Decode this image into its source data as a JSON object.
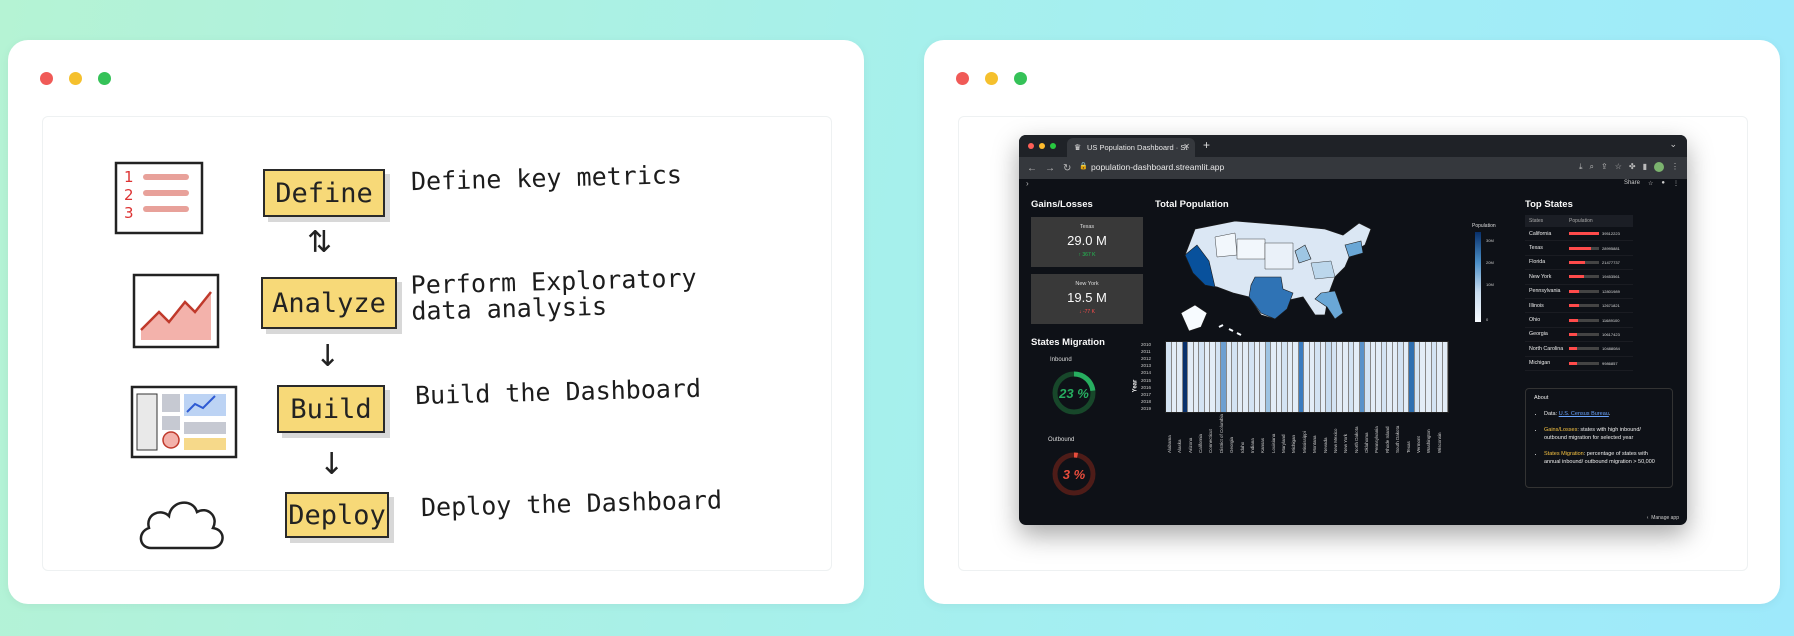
{
  "workflow": {
    "steps": [
      {
        "label": "Define",
        "description": "Define key metrics"
      },
      {
        "label": "Analyze",
        "description": "Perform Exploratory data analysis"
      },
      {
        "label": "Build",
        "description": "Build the Dashboard"
      },
      {
        "label": "Deploy",
        "description": "Deploy the Dashboard"
      }
    ],
    "icon_list_numbers": [
      "1",
      "2",
      "3"
    ]
  },
  "browser": {
    "tab_title": "US Population Dashboard · St",
    "url": "population-dashboard.streamlit.app",
    "share_label": "Share"
  },
  "dashboard": {
    "gains_losses": {
      "title": "Gains/Losses",
      "metrics": [
        {
          "label": "Texas",
          "value": "29.0 M",
          "delta": "↑ 367 K",
          "delta_color": "#21c354"
        },
        {
          "label": "New York",
          "value": "19.5 M",
          "delta": "↓ -77 K",
          "delta_color": "#ff4b4b"
        }
      ]
    },
    "migration": {
      "title": "States Migration",
      "inbound": {
        "label": "Inbound",
        "value": "23 %",
        "fraction": 0.23,
        "color": "#27ae60"
      },
      "outbound": {
        "label": "Outbound",
        "value": "3 %",
        "fraction": 0.03,
        "color": "#e74c3c"
      }
    },
    "map": {
      "title": "Total Population",
      "legend": {
        "title": "Population",
        "ticks": [
          "30M",
          "20M",
          "10M",
          "0"
        ]
      }
    },
    "heatmap": {
      "y_title": "Year",
      "years": [
        "2010",
        "2011",
        "2012",
        "2013",
        "2014",
        "2015",
        "2016",
        "2017",
        "2018",
        "2019"
      ],
      "states": [
        "Alabama",
        "Alaska",
        "Arizona",
        "California",
        "Connecticut",
        "District of Columbia",
        "Georgia",
        "Idaho",
        "Indiana",
        "Kansas",
        "Louisiana",
        "Maryland",
        "Michigan",
        "Mississippi",
        "Montana",
        "Nevada",
        "New Mexico",
        "New York",
        "North Dakota",
        "Oklahoma",
        "Pennsylvania",
        "Rhode Island",
        "South Dakota",
        "Texas",
        "Vermont",
        "Washington",
        "Wisconsin"
      ]
    },
    "top_states": {
      "title": "Top States",
      "columns": [
        "States",
        "Population"
      ],
      "rows": [
        {
          "state": "California",
          "population": "39512223",
          "fraction": 1.0
        },
        {
          "state": "Texas",
          "population": "28995881",
          "fraction": 0.73
        },
        {
          "state": "Florida",
          "population": "21477737",
          "fraction": 0.54
        },
        {
          "state": "New York",
          "population": "19453561",
          "fraction": 0.49
        },
        {
          "state": "Pennsylvania",
          "population": "12801989",
          "fraction": 0.32
        },
        {
          "state": "Illinois",
          "population": "12671821",
          "fraction": 0.32
        },
        {
          "state": "Ohio",
          "population": "11689100",
          "fraction": 0.3
        },
        {
          "state": "Georgia",
          "population": "10617423",
          "fraction": 0.27
        },
        {
          "state": "North Carolina",
          "population": "10488084",
          "fraction": 0.27
        },
        {
          "state": "Michigan",
          "population": "9986857",
          "fraction": 0.25
        }
      ]
    },
    "about": {
      "title": "About",
      "data_prefix": "Data: ",
      "data_link": "U.S. Census Bureau",
      "data_suffix": ".",
      "gains_label": "Gains/Losses",
      "gains_text": ": states with high inbound/ outbound migration for selected year",
      "migration_label": "States Migration",
      "migration_text": ": percentage of states with annual inbound/ outbound migration > 50,000"
    },
    "manage_app": "Manage app"
  }
}
